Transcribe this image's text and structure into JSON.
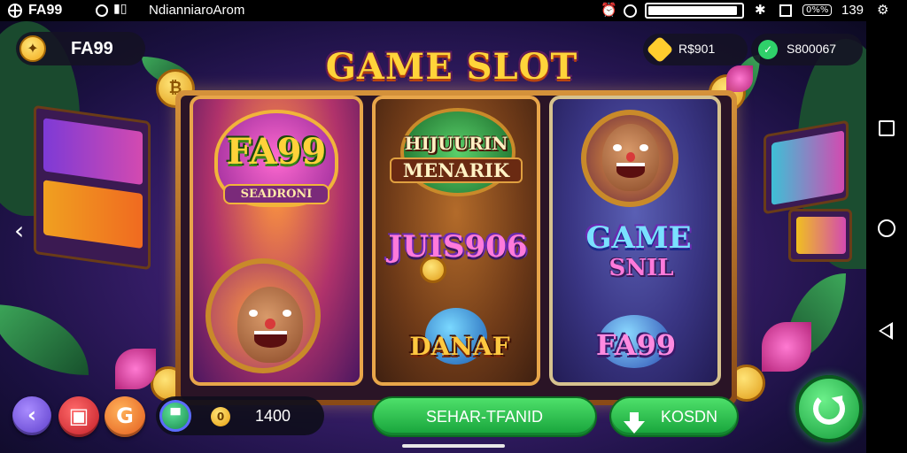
{
  "status_bar": {
    "app_name": "FA99",
    "title": "NdianniaroAr​om",
    "battery_fill_pct": 96,
    "pill_text": "0%%",
    "time": "139"
  },
  "top_bar": {
    "brand_name": "FA99",
    "balance_1": "R$901",
    "balance_2": "S800067"
  },
  "title": "GAME SLOT",
  "reels": [
    {
      "symbols": [
        {
          "line1": "FA99",
          "line2": "SEADRONI"
        }
      ]
    },
    {
      "symbols": [
        {
          "line1": "HIJUURIN",
          "line2": "MENARIK"
        },
        {
          "line1": "JUIS906"
        },
        {
          "line1": "DANAF"
        }
      ]
    },
    {
      "symbols": [
        {
          "line1": "GAME",
          "line2": "SNIL"
        },
        {
          "line1": "FA99"
        }
      ]
    }
  ],
  "bottom_bar": {
    "credit_value": "1400",
    "main_button": "SEHAR-TFANID",
    "secondary_button": "KOSDN"
  },
  "colors": {
    "title_fill": "#ffd43a",
    "green_button": "#2bc44f",
    "frame_gold": "#d5923a"
  },
  "icons": {
    "brand": "star-coin-icon",
    "balance_1": "diamond-icon",
    "balance_2": "leaf-icon",
    "back": "chevron-left-icon",
    "spin": "refresh-icon"
  }
}
